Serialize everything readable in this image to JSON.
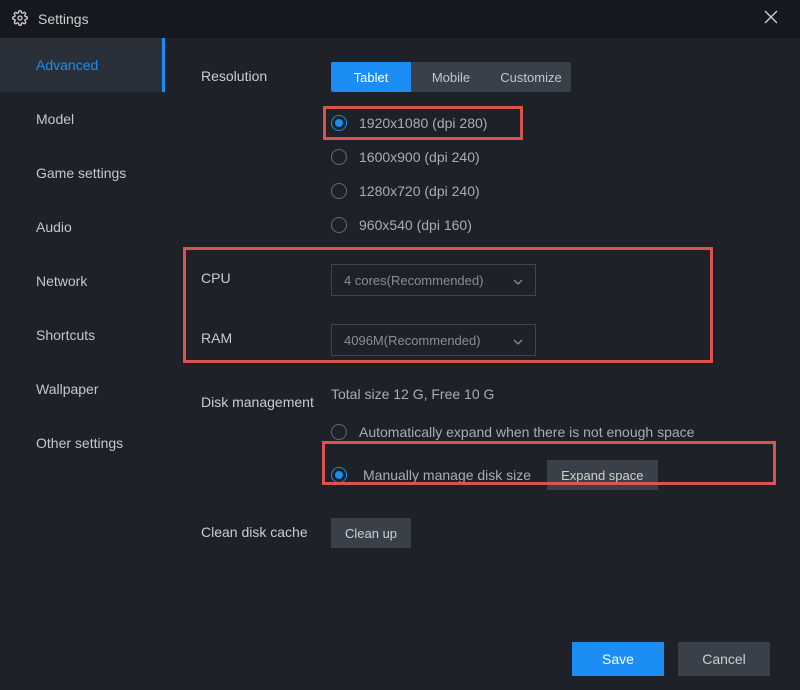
{
  "titlebar": {
    "title": "Settings"
  },
  "sidebar": {
    "items": [
      {
        "label": "Advanced",
        "active": true
      },
      {
        "label": "Model"
      },
      {
        "label": "Game settings"
      },
      {
        "label": "Audio"
      },
      {
        "label": "Network"
      },
      {
        "label": "Shortcuts"
      },
      {
        "label": "Wallpaper"
      },
      {
        "label": "Other settings"
      }
    ]
  },
  "resolution": {
    "label": "Resolution",
    "tabs": {
      "tablet": "Tablet",
      "mobile": "Mobile",
      "customize": "Customize"
    },
    "options": [
      {
        "label": "1920x1080  (dpi 280)",
        "checked": true
      },
      {
        "label": "1600x900  (dpi 240)"
      },
      {
        "label": "1280x720  (dpi 240)"
      },
      {
        "label": "960x540  (dpi 160)"
      }
    ]
  },
  "cpu": {
    "label": "CPU",
    "value": "4 cores(Recommended)"
  },
  "ram": {
    "label": "RAM",
    "value": "4096M(Recommended)"
  },
  "disk": {
    "label": "Disk management",
    "info": "Total size 12 G,   Free 10 G",
    "auto": "Automatically expand when there is not enough space",
    "manual": "Manually manage disk size",
    "expand_btn": "Expand space"
  },
  "clean": {
    "label": "Clean disk cache",
    "btn": "Clean up"
  },
  "footer": {
    "save": "Save",
    "cancel": "Cancel"
  }
}
